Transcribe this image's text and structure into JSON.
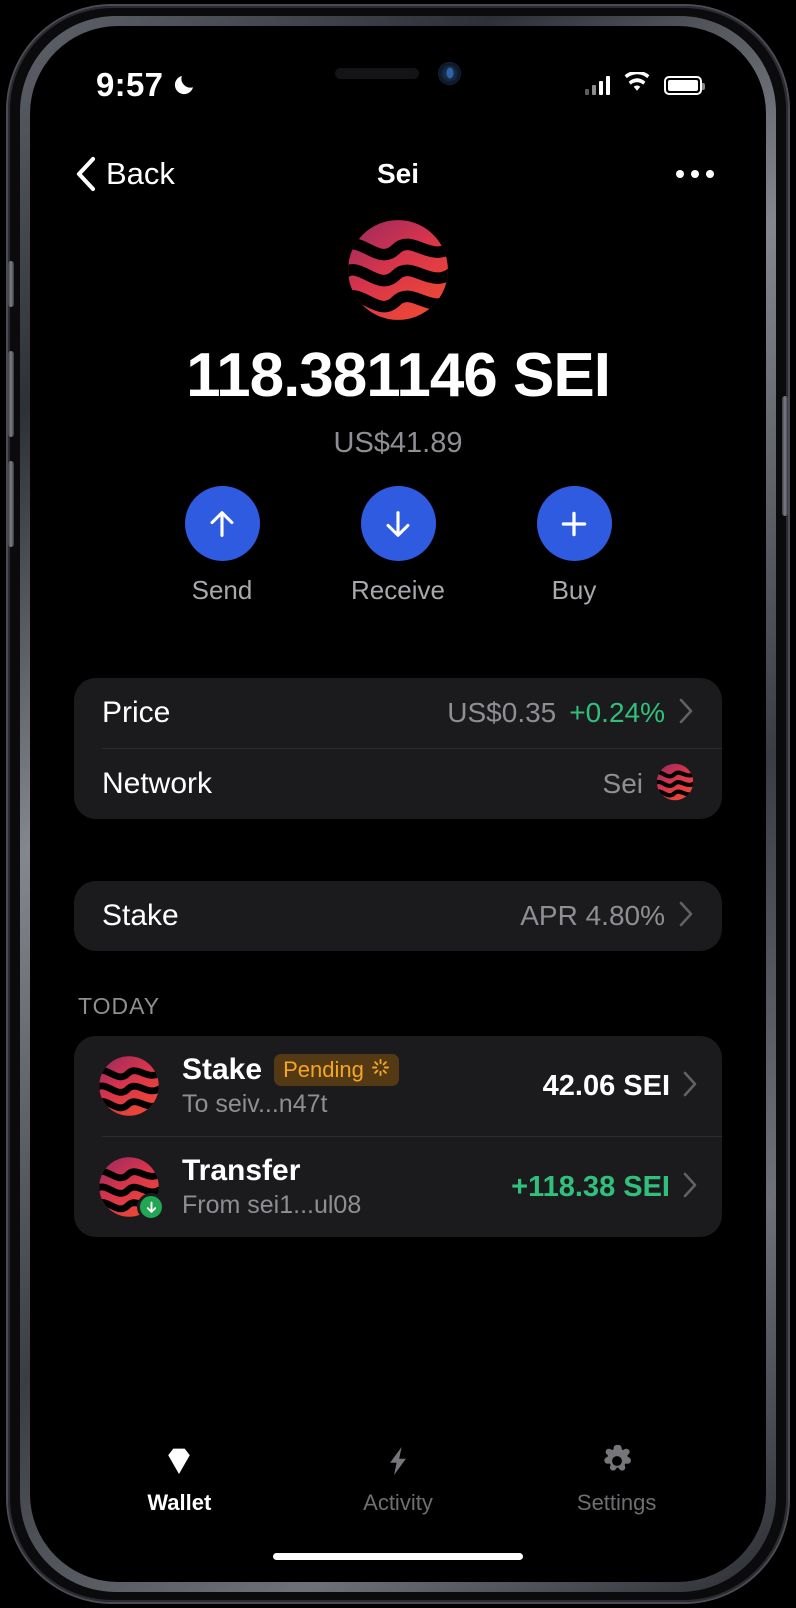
{
  "status_bar": {
    "time": "9:57",
    "dnd_icon": "crescent-moon-icon",
    "signal_icon": "cellular-bars-icon",
    "wifi_icon": "wifi-icon",
    "battery_icon": "battery-full-icon"
  },
  "nav": {
    "back_label": "Back",
    "back_icon": "chevron-left-icon",
    "title": "Sei",
    "more_icon": "more-horizontal-icon"
  },
  "token": {
    "logo_icon": "sei-logo-icon",
    "balance": "118.381146 SEI",
    "fiat_value": "US$41.89"
  },
  "actions": [
    {
      "label": "Send",
      "icon": "arrow-up-icon"
    },
    {
      "label": "Receive",
      "icon": "arrow-down-icon"
    },
    {
      "label": "Buy",
      "icon": "plus-icon"
    }
  ],
  "info_card": {
    "price": {
      "label": "Price",
      "value": "US$0.35",
      "change": "+0.24%",
      "chevron_icon": "chevron-right-icon"
    },
    "network": {
      "label": "Network",
      "value": "Sei",
      "icon": "sei-logo-icon"
    }
  },
  "stake_card": {
    "label": "Stake",
    "value": "APR 4.80%",
    "chevron_icon": "chevron-right-icon"
  },
  "transactions": {
    "section_title": "TODAY",
    "items": [
      {
        "icon": "sei-logo-icon",
        "badge_icon": "",
        "title": "Stake",
        "status_badge": "Pending",
        "status_spinner_icon": "spinner-icon",
        "subtitle": "To seiv...n47t",
        "amount": "42.06 SEI",
        "amount_positive": false,
        "chevron_icon": "chevron-right-icon"
      },
      {
        "icon": "sei-logo-icon",
        "badge_icon": "arrow-down-circle-icon",
        "title": "Transfer",
        "status_badge": "",
        "status_spinner_icon": "",
        "subtitle": "From sei1...ul08",
        "amount": "+118.38 SEI",
        "amount_positive": true,
        "chevron_icon": "chevron-right-icon"
      }
    ]
  },
  "tabs": [
    {
      "label": "Wallet",
      "icon": "gem-icon",
      "active": true
    },
    {
      "label": "Activity",
      "icon": "lightning-bolt-icon",
      "active": false
    },
    {
      "label": "Settings",
      "icon": "gear-icon",
      "active": false
    }
  ],
  "colors": {
    "accent_blue": "#2f5be0",
    "positive_green": "#31c07c",
    "pending_orange": "#f5a623",
    "pending_bg": "#533a15",
    "badge_green": "#23a653",
    "card_bg": "#1b1b1d",
    "muted_text": "#8e8e93"
  }
}
